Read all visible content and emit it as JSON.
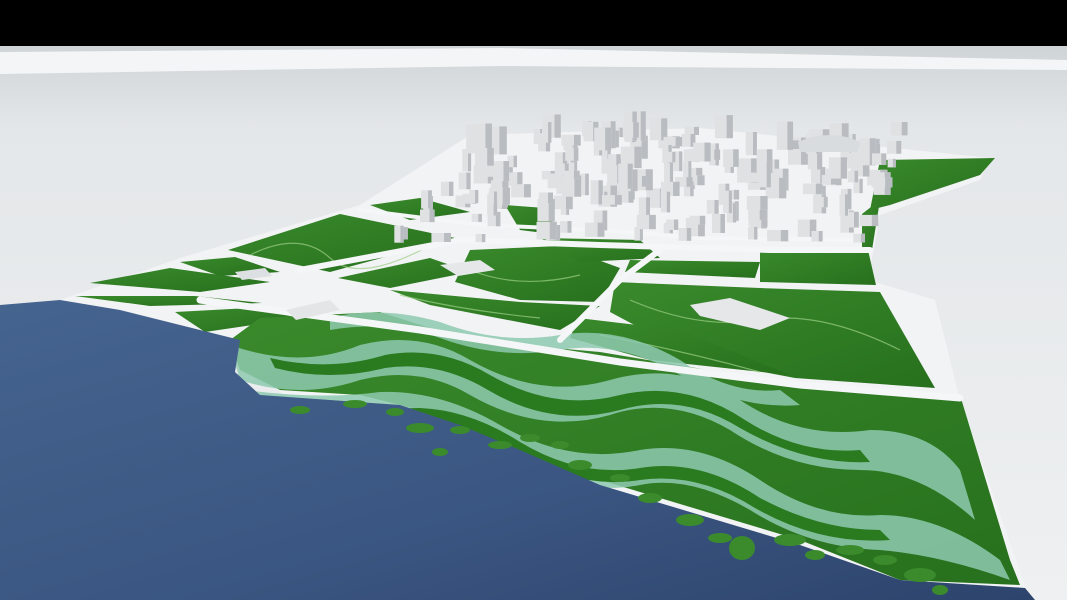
{
  "scene": {
    "subject": "3d-urban-masterplan-model",
    "colors": {
      "letterbox": "#000000",
      "ground": "#e7eaec",
      "ground_far": "#d9dde0",
      "road": "#f3f4f5",
      "grass": "#2f7d22",
      "grass_dark": "#1f5f16",
      "grass_light": "#4e9a3c",
      "water": "#3d5a86",
      "water_dark": "#2b426b",
      "shallow": "#8fc9b0",
      "building": "#dfe1e3",
      "building_shade": "#b9bdc1"
    }
  }
}
